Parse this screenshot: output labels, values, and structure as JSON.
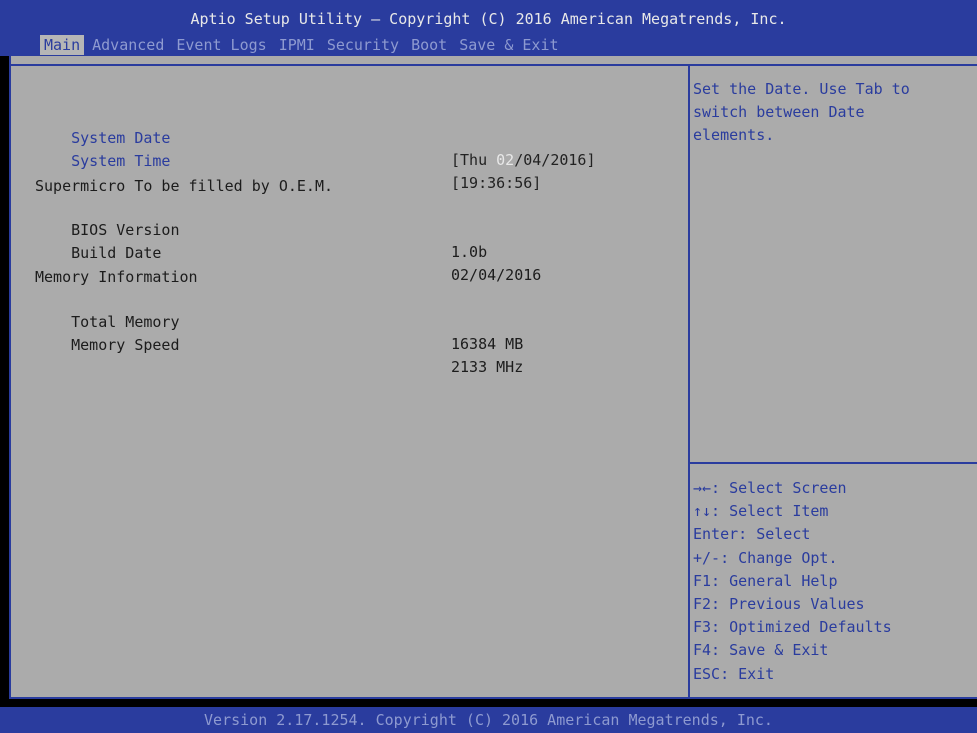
{
  "header": {
    "title": "Aptio Setup Utility – Copyright (C) 2016 American Megatrends, Inc.",
    "tabs": [
      "Main",
      "Advanced",
      "Event Logs",
      "IPMI",
      "Security",
      "Boot",
      "Save & Exit"
    ],
    "active_tab": "Main"
  },
  "main": {
    "system_date": {
      "label": "System Date",
      "value_prefix": "[Thu ",
      "value_highlight": "02",
      "value_suffix": "/04/2016]"
    },
    "system_time": {
      "label": "System Time",
      "value": "[19:36:56]"
    },
    "oem_line": "Supermicro To be filled by O.E.M.",
    "bios_version": {
      "label": "BIOS Version",
      "value": "1.0b"
    },
    "build_date": {
      "label": "Build Date",
      "value": "02/04/2016"
    },
    "memory_heading": "Memory Information",
    "total_memory": {
      "label": "Total Memory",
      "value": "16384 MB"
    },
    "memory_speed": {
      "label": "Memory Speed",
      "value": "2133 MHz"
    }
  },
  "help": {
    "text_lines": [
      "Set the Date. Use Tab to",
      "switch between Date",
      "elements."
    ]
  },
  "keys": [
    "→←: Select Screen",
    "↑↓: Select Item",
    "Enter: Select",
    "+/-: Change Opt.",
    "F1: General Help",
    "F2: Previous Values",
    "F3: Optimized Defaults",
    "F4: Save & Exit",
    "ESC: Exit"
  ],
  "footer": {
    "text": "Version 2.17.1254. Copyright (C) 2016 American Megatrends, Inc."
  },
  "colors": {
    "bar_blue": "#2a3c9e",
    "panel_gray": "#ababab",
    "dim_text": "#8e9ad0"
  }
}
